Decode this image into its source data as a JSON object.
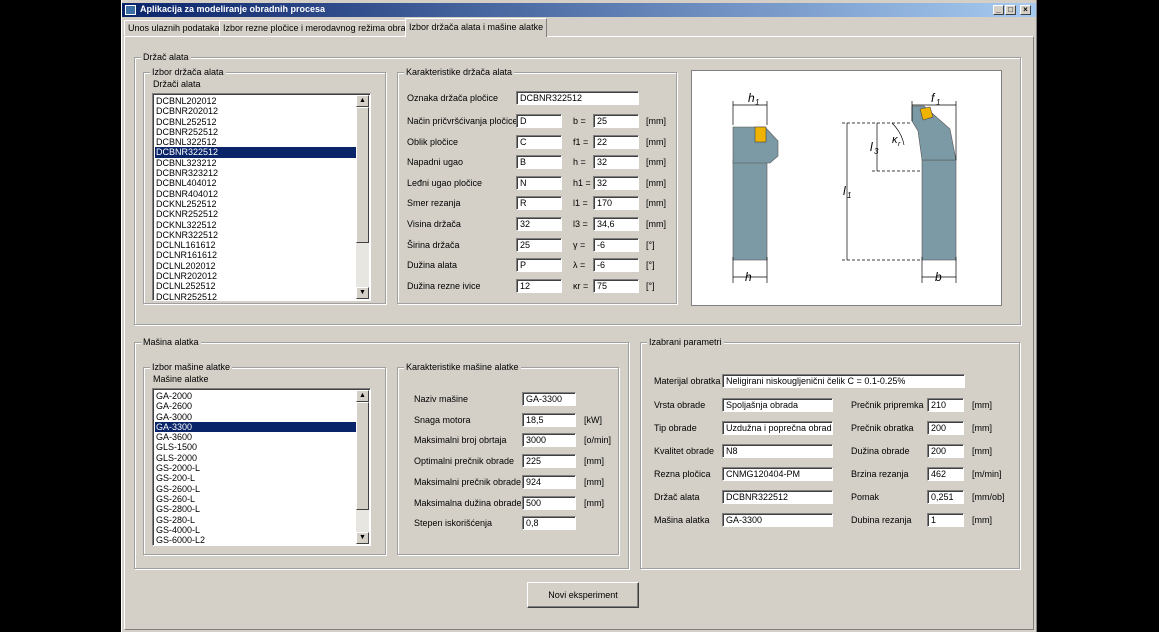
{
  "window": {
    "title": "Aplikacija za modeliranje obradnih procesa"
  },
  "tabs": [
    "Unos ulaznih podataka",
    "Izbor rezne pločice i merodavnog režima obrade",
    "Izbor držača alata i mašine alatke"
  ],
  "holder_section": {
    "title": "Držač alata",
    "select_group": "Izbor držača alata",
    "list_label": "Držači alata",
    "items": [
      "DCBNL202012",
      "DCBNR202012",
      "DCBNL252512",
      "DCBNR252512",
      "DCBNL322512",
      "DCBNR322512",
      "DCBNL323212",
      "DCBNR323212",
      "DCBNL404012",
      "DCBNR404012",
      "DCKNL252512",
      "DCKNR252512",
      "DCKNL322512",
      "DCKNR322512",
      "DCLNL161612",
      "DCLNR161612",
      "DCLNL202012",
      "DCLNR202012",
      "DCLNL252512",
      "DCLNR252512"
    ],
    "selected": "DCBNR322512",
    "char_group": "Karakteristike držača alata",
    "fields": {
      "designation": {
        "label": "Oznaka držača pločice",
        "value": "DCBNR322512"
      },
      "clamping": {
        "label": "Način pričvršćivanja pločice",
        "value": "D"
      },
      "shape": {
        "label": "Oblik pločice",
        "value": "C"
      },
      "approach": {
        "label": "Napadni ugao",
        "value": "B"
      },
      "clearance": {
        "label": "Leđni ugao pločice",
        "value": "N"
      },
      "direction": {
        "label": "Smer rezanja",
        "value": "R"
      },
      "height": {
        "label": "Visina držača",
        "value": "32"
      },
      "width": {
        "label": "Širina držača",
        "value": "25"
      },
      "length": {
        "label": "Dužina alata",
        "value": "P"
      },
      "edge": {
        "label": "Dužina rezne ivice",
        "value": "12"
      }
    },
    "dims": [
      {
        "label": "b =",
        "value": "25",
        "unit": "[mm]"
      },
      {
        "label": "f1 =",
        "value": "22",
        "unit": "[mm]"
      },
      {
        "label": "h =",
        "value": "32",
        "unit": "[mm]"
      },
      {
        "label": "h1 =",
        "value": "32",
        "unit": "[mm]"
      },
      {
        "label": "l1 =",
        "value": "170",
        "unit": "[mm]"
      },
      {
        "label": "l3 =",
        "value": "34,6",
        "unit": "[mm]"
      },
      {
        "label": "γ =",
        "value": "-6",
        "unit": "[°]"
      },
      {
        "label": "λ =",
        "value": "-6",
        "unit": "[°]"
      },
      {
        "label": "κr =",
        "value": "75",
        "unit": "[°]"
      }
    ],
    "diagram": {
      "h1": "h",
      "h1_sub": "1",
      "f1": "f",
      "f1_sub": "1",
      "l3": "l",
      "l3_sub": "3",
      "l1": "l",
      "l1_sub": "1",
      "h": "h",
      "b": "b",
      "kr": "κ",
      "kr_sub": "r"
    }
  },
  "machine_section": {
    "title": "Mašina alatka",
    "select_group": "Izbor mašine alatke",
    "list_label": "Mašine alatke",
    "items": [
      "GA-2000",
      "GA-2600",
      "GA-3000",
      "GA-3300",
      "GA-3600",
      "GLS-1500",
      "GLS-2000",
      "GS-2000-L",
      "GS-200-L",
      "GS-2600-L",
      "GS-260-L",
      "GS-2800-L",
      "GS-280-L",
      "GS-4000-L",
      "GS-6000-L2"
    ],
    "selected": "GA-3300",
    "char_group": "Karakteristike mašine alatke",
    "fields": [
      {
        "label": "Naziv mašine",
        "value": "GA-3300",
        "unit": ""
      },
      {
        "label": "Snaga motora",
        "value": "18,5",
        "unit": "[kW]"
      },
      {
        "label": "Maksimalni broj obrtaja",
        "value": "3000",
        "unit": "[o/min]"
      },
      {
        "label": "Optimalni prečnik obrade",
        "value": "225",
        "unit": "[mm]"
      },
      {
        "label": "Maksimalni prečnik obrade",
        "value": "924",
        "unit": "[mm]"
      },
      {
        "label": "Maksimalna dužina obrade",
        "value": "500",
        "unit": "[mm]"
      },
      {
        "label": "Stepen iskorišćenja",
        "value": "0,8",
        "unit": ""
      }
    ]
  },
  "params": {
    "title": "Izabrani parametri",
    "material": {
      "label": "Materijal obratka",
      "value": "Neligirani niskougljenični čelik C = 0.1-0.25%"
    },
    "left": [
      {
        "label": "Vrsta obrade",
        "value": "Spoljašnja obrada"
      },
      {
        "label": "Tip obrade",
        "value": "Uzdužna i poprečna obrada"
      },
      {
        "label": "Kvalitet obrade",
        "value": "N8"
      },
      {
        "label": "Rezna pločica",
        "value": "CNMG120404-PM"
      },
      {
        "label": "Držač alata",
        "value": "DCBNR322512"
      },
      {
        "label": "Mašina alatka",
        "value": "GA-3300"
      }
    ],
    "right": [
      {
        "label": "Prečnik pripremka",
        "value": "210",
        "unit": "[mm]"
      },
      {
        "label": "Prečnik obratka",
        "value": "200",
        "unit": "[mm]"
      },
      {
        "label": "Dužina obrade",
        "value": "200",
        "unit": "[mm]"
      },
      {
        "label": "Brzina rezanja",
        "value": "462",
        "unit": "[m/min]"
      },
      {
        "label": "Pomak",
        "value": "0,251",
        "unit": "[mm/ob]"
      },
      {
        "label": "Dubina rezanja",
        "value": "1",
        "unit": "[mm]"
      }
    ]
  },
  "actions": {
    "new_experiment": "Novi eksperiment"
  },
  "caption_buttons": {
    "minimize": "_",
    "maximize": "□",
    "close": "×"
  }
}
